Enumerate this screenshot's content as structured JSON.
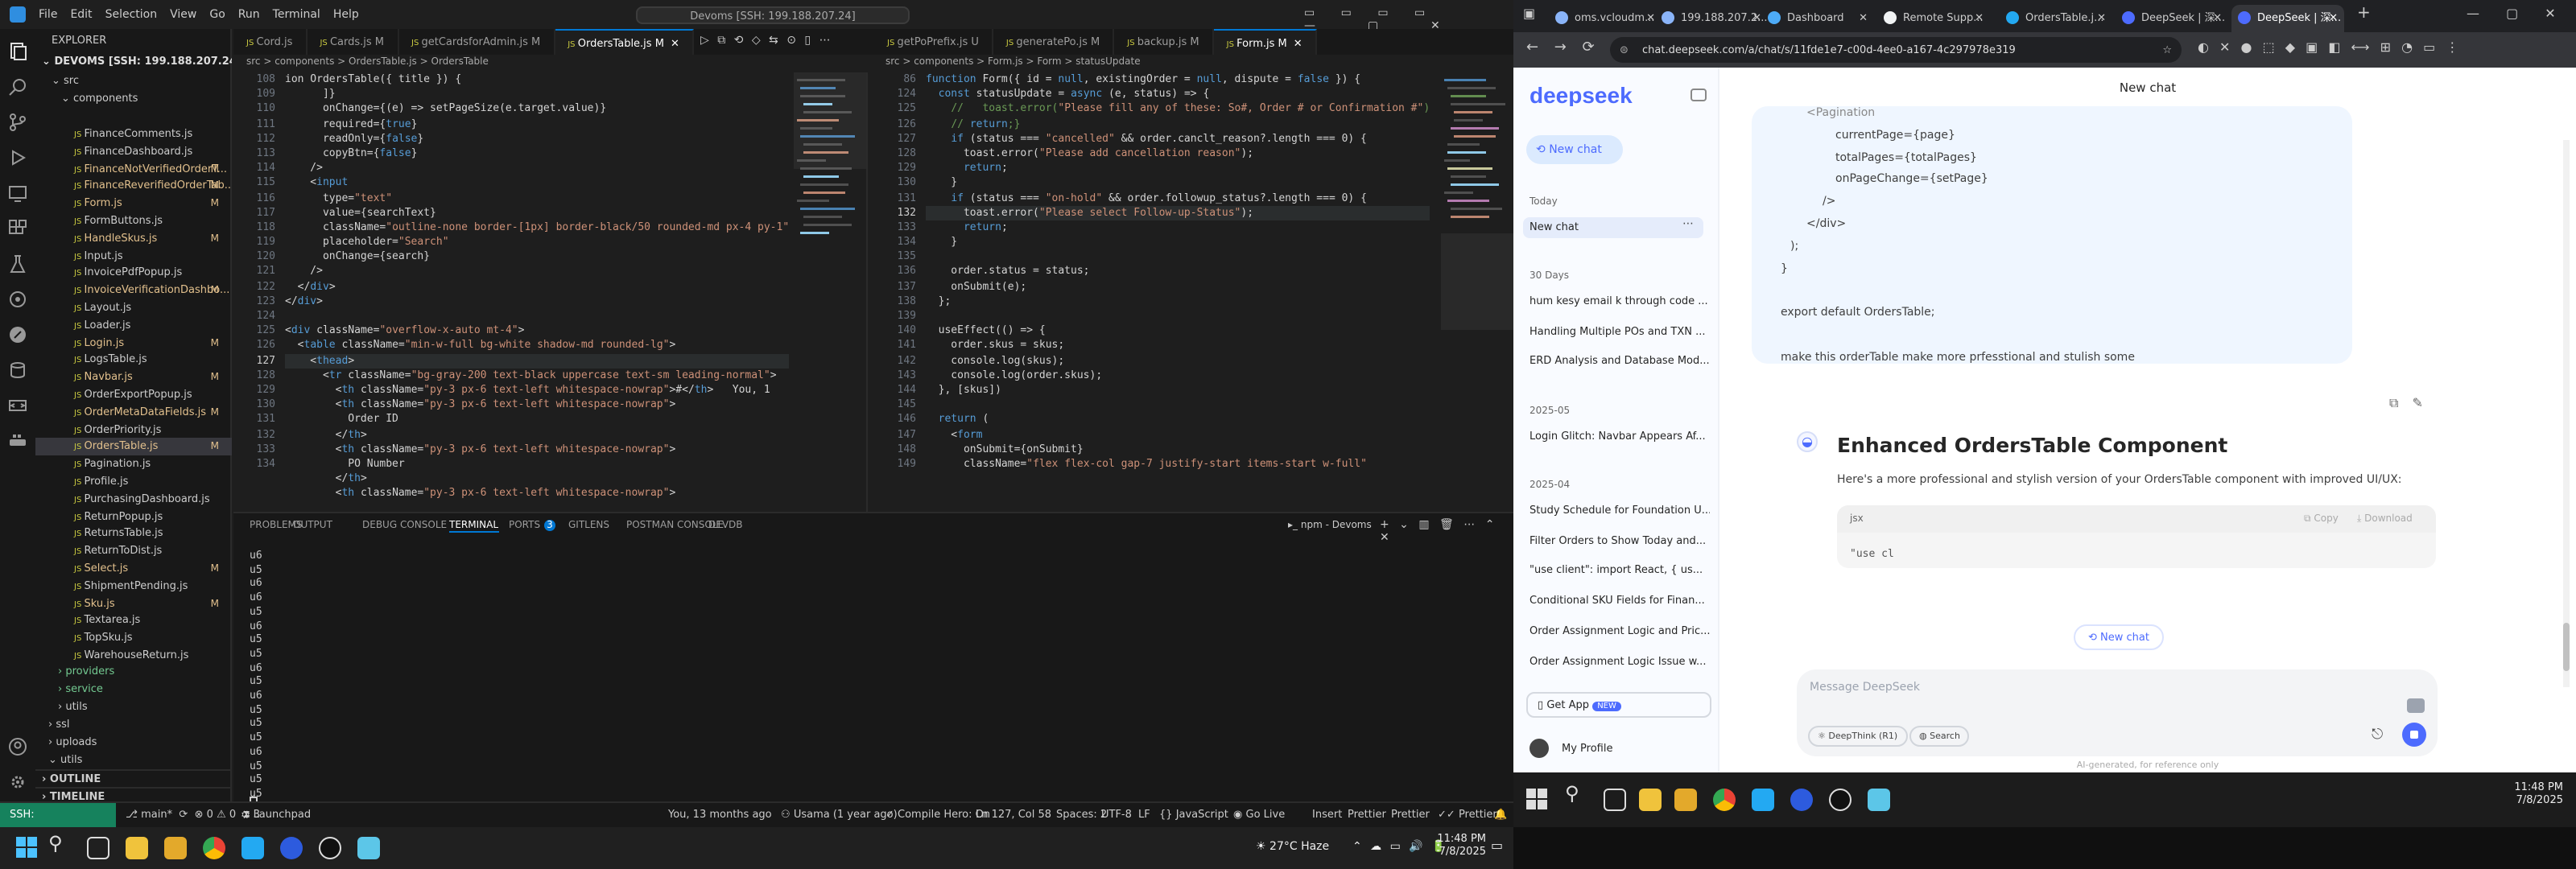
{
  "vscode": {
    "menu": [
      "File",
      "Edit",
      "Selection",
      "View",
      "Go",
      "Run",
      "Terminal",
      "Help"
    ],
    "command_center": "Devoms [SSH: 199.188.207.24]",
    "explorer": {
      "title": "EXPLORER",
      "root": "DEVOMS [SSH: 199.188.207.24]",
      "src": "src",
      "components": "components",
      "files": [
        {
          "name": "FinanceComments.js",
          "mark": ""
        },
        {
          "name": "FinanceDashboard.js",
          "mark": ""
        },
        {
          "name": "FinanceNotVerifiedOrderT...",
          "mark": "M"
        },
        {
          "name": "FinanceReverifiedOrderTab...",
          "mark": "M"
        },
        {
          "name": "Form.js",
          "mark": "M"
        },
        {
          "name": "FormButtons.js",
          "mark": ""
        },
        {
          "name": "HandleSkus.js",
          "mark": "M"
        },
        {
          "name": "Input.js",
          "mark": ""
        },
        {
          "name": "InvoicePdfPopup.js",
          "mark": ""
        },
        {
          "name": "InvoiceVerificationDashbo...",
          "mark": "M"
        },
        {
          "name": "Layout.js",
          "mark": ""
        },
        {
          "name": "Loader.js",
          "mark": ""
        },
        {
          "name": "Login.js",
          "mark": "M"
        },
        {
          "name": "LogsTable.js",
          "mark": ""
        },
        {
          "name": "Navbar.js",
          "mark": "M"
        },
        {
          "name": "OrderExportPopup.js",
          "mark": ""
        },
        {
          "name": "OrderMetaDataFields.js",
          "mark": "M"
        },
        {
          "name": "OrderPriority.js",
          "mark": ""
        },
        {
          "name": "OrdersTable.js",
          "mark": "M"
        },
        {
          "name": "Pagination.js",
          "mark": ""
        },
        {
          "name": "Profile.js",
          "mark": ""
        },
        {
          "name": "PurchasingDashboard.js",
          "mark": ""
        },
        {
          "name": "ReturnPopup.js",
          "mark": ""
        },
        {
          "name": "ReturnsTable.js",
          "mark": ""
        },
        {
          "name": "ReturnToDist.js",
          "mark": ""
        },
        {
          "name": "Select.js",
          "mark": "M"
        },
        {
          "name": "ShipmentPending.js",
          "mark": ""
        },
        {
          "name": "Sku.js",
          "mark": "M"
        },
        {
          "name": "Textarea.js",
          "mark": ""
        },
        {
          "name": "TopSku.js",
          "mark": ""
        },
        {
          "name": "WarehouseReturn.js",
          "mark": ""
        }
      ],
      "folders": [
        "providers",
        "service",
        "utils",
        "ssl",
        "uploads",
        "utils"
      ],
      "outline": "OUTLINE",
      "timeline": "TIMELINE"
    },
    "tabs_left": [
      "Cord.js",
      "Cards.js M",
      "getCardsforAdmin.js M",
      "OrdersTable.js M"
    ],
    "tabs_right": [
      "getPoPrefix.js U",
      "generatePo.js M",
      "backup.js M",
      "Form.js M"
    ],
    "crumb_left": "src > components > OrdersTable.js > OrdersTable",
    "crumb_right": "src > components > Form.js > Form > statusUpdate",
    "left_gutter": [
      "108",
      "109",
      "110",
      "111",
      "112",
      "113",
      "114",
      "115",
      "116",
      "117",
      "118",
      "119",
      "120",
      "121",
      "122",
      "123",
      "124",
      "125",
      "126",
      "127",
      "128",
      "129",
      "130",
      "131",
      "132",
      "133",
      "134"
    ],
    "left_code": [
      "ion OrdersTable({ title }) {",
      "      ]}",
      "      onChange={(e) => setPageSize(e.target.value)}",
      "      required={true}",
      "      readOnly={false}",
      "      copyBtn={false}",
      "    />",
      "    <input",
      "      type=\"text\"",
      "      value={searchText}",
      "      className=\"outline-none border-[1px] border-black/50 rounded-md px-4 py-1\"",
      "      placeholder=\"Search\"",
      "      onChange={search}",
      "    />",
      "  </div>",
      "</div>",
      "",
      "<div className=\"overflow-x-auto mt-4\">",
      "  <table className=\"min-w-full bg-white shadow-md rounded-lg\">",
      "    <thead>",
      "      <tr className=\"bg-gray-200 text-black uppercase text-sm leading-normal\">",
      "        <th className=\"py-3 px-6 text-left whitespace-nowrap\">#</th>   You, 1",
      "        <th className=\"py-3 px-6 text-left whitespace-nowrap\">",
      "          Order ID",
      "        </th>",
      "        <th className=\"py-3 px-6 text-left whitespace-nowrap\">",
      "          PO Number",
      "        </th>",
      "        <th className=\"py-3 px-6 text-left whitespace-nowrap\">"
    ],
    "right_gutter": [
      "86",
      "124",
      "125",
      "126",
      "127",
      "128",
      "129",
      "130",
      "131",
      "132",
      "133",
      "134",
      "135",
      "136",
      "137",
      "138",
      "139",
      "140",
      "141",
      "142",
      "143",
      "144",
      "145",
      "146",
      "147",
      "148",
      "149"
    ],
    "right_code": [
      "function Form({ id = null, existingOrder = null, dispute = false }) {",
      "  const statusUpdate = async (e, status) => {",
      "    //   toast.error(\"Please fill any of these: So#, Order # or Confirmation #\")",
      "    // return;}",
      "    if (status === \"cancelled\" && order.canclt_reason?.length === 0) {",
      "      toast.error(\"Please add cancellation reason\");",
      "      return;",
      "    }",
      "    if (status === \"on-hold\" && order.followup_status?.length === 0) {",
      "      toast.error(\"Please select Follow-up-Status\");",
      "      return;",
      "    }",
      "",
      "    order.status = status;",
      "    onSubmit(e);",
      "  };",
      "",
      "  useEffect(() => {",
      "    order.skus = skus;",
      "    console.log(skus);",
      "    console.log(order.skus);",
      "  }, [skus])",
      "",
      "  return (",
      "    <form",
      "      onSubmit={onSubmit}",
      "      className=\"flex flex-col gap-7 justify-start items-start w-full\""
    ],
    "panel_tabs": [
      "PROBLEMS",
      "OUTPUT",
      "DEBUG CONSOLE",
      "TERMINAL",
      "PORTS",
      "GITLENS",
      "POSTMAN CONSOLE",
      "DEVDB"
    ],
    "ports_badge": "3",
    "terminal_name": "npm - Devoms",
    "terminal_lines": [
      "u6",
      "u5",
      "u6",
      "u6",
      "u5",
      "u6",
      "u5",
      "u5",
      "u6",
      "u5",
      "u6",
      "u5",
      "u5",
      "u5",
      "u6",
      "u5",
      "u5",
      "u5"
    ],
    "status": {
      "ssh": "SSH: 199.188.207.24",
      "branch": "main*",
      "errors": "0",
      "warnings": "0",
      "ports": "3",
      "launchpad": "Launchpad",
      "blame": "You, 13 months ago",
      "author": "Usama (1 year ago)",
      "compile": "Compile Hero: On",
      "position": "Ln 127, Col 58",
      "spaces": "Spaces: 2",
      "encoding": "UTF-8",
      "eol": "LF",
      "language": "JavaScript",
      "golive": "Go Live",
      "insert": "Insert",
      "prettier1": "Prettier",
      "prettier2": "Prettier",
      "prettier3": "Prettier"
    }
  },
  "chrome": {
    "tabs": [
      "oms.vcloudm...",
      "199.188.207.2...",
      "Dashboard",
      "Remote Supp...",
      "OrdersTable.j...",
      "DeepSeek | 深...",
      "DeepSeek | 深..."
    ],
    "url": "chat.deepseek.com/a/chat/s/11fde1e7-c00d-4ee0-a167-4c297978e319"
  },
  "deepseek": {
    "logo": "deepseek",
    "new_chat": "New chat",
    "header": "New chat",
    "today": "Today",
    "today_item": "New chat",
    "group30": "30 Days",
    "items30": [
      "hum kesy email k through code ...",
      "Handling Multiple POs and TXN ...",
      "ERD Analysis and Database Mod..."
    ],
    "group05": "2025-05",
    "items05": [
      "Login Glitch: Navbar Appears Af..."
    ],
    "group04": "2025-04",
    "items04": [
      "Study Schedule for Foundation U...",
      "Filter Orders to Show Today and...",
      "\"use client\": import React, { us...",
      "Conditional SKU Fields for Finan...",
      "Order Assignment Logic and Pric...",
      "Order Assignment Logic Issue w..."
    ],
    "get_app": "Get App",
    "new_badge": "NEW",
    "profile": "My Profile",
    "user_code": [
      "<Pagination",
      "  currentPage={page}",
      "  totalPages={totalPages}",
      "  onPageChange={setPage}",
      "/>",
      "</div>",
      "  );",
      "}",
      "",
      "export default OrdersTable;",
      "",
      "make this orderTable make more prfesstional and stulish some"
    ],
    "answer_title": "Enhanced OrdersTable Component",
    "answer_intro": "Here's a more professional and stylish version of your OrdersTable component with improved UI/UX:",
    "code_lang": "jsx",
    "copy": "Copy",
    "download": "Download",
    "code_start": "\"use cl",
    "float_new_chat": "New chat",
    "input_placeholder": "Message DeepSeek",
    "deepthink": "DeepThink (R1)",
    "search": "Search",
    "footer": "AI-generated, for reference only"
  },
  "taskbar": {
    "weather": "27°C  Haze",
    "time": "11:48 PM",
    "date": "7/8/2025"
  },
  "colors": {
    "accent": "#0078d4",
    "ds_blue": "#4d6bfe",
    "ssh_green": "#16825d"
  }
}
